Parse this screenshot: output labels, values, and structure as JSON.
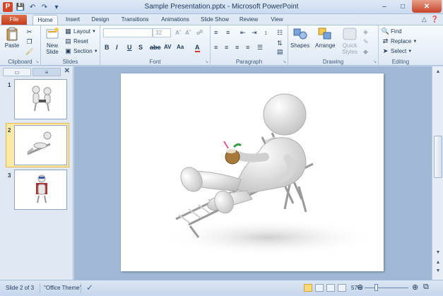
{
  "window": {
    "title": "Sample Presentation.pptx - Microsoft PowerPoint",
    "app_letter": "P",
    "minimize": "–",
    "maximize": "□",
    "close": "✕"
  },
  "tabs": {
    "file": "File",
    "items": [
      "Home",
      "Insert",
      "Design",
      "Transitions",
      "Animations",
      "Slide Show",
      "Review",
      "View"
    ]
  },
  "ribbon": {
    "clipboard": {
      "label": "Clipboard",
      "paste": "Paste"
    },
    "slides": {
      "label": "Slides",
      "new_slide_1": "New",
      "new_slide_2": "Slide",
      "layout": "Layout",
      "reset": "Reset",
      "section": "Section"
    },
    "font": {
      "label": "Font",
      "font_size": "32"
    },
    "paragraph": {
      "label": "Paragraph"
    },
    "drawing": {
      "label": "Drawing",
      "shapes": "Shapes",
      "arrange": "Arrange",
      "quick_styles_1": "Quick",
      "quick_styles_2": "Styles"
    },
    "editing": {
      "label": "Editing",
      "find": "Find",
      "replace": "Replace",
      "select": "Select"
    }
  },
  "slides_pane": {
    "numbers": [
      "1",
      "2",
      "3"
    ],
    "selected": 2
  },
  "status": {
    "slide_info": "Slide 2 of 3",
    "theme": "\"Office Theme\"",
    "zoom": "57%"
  },
  "colors": {
    "accent_file_tab": "#c43e1c",
    "selection": "#fdeaa6",
    "ribbon_bg": "#dfe9f5"
  }
}
